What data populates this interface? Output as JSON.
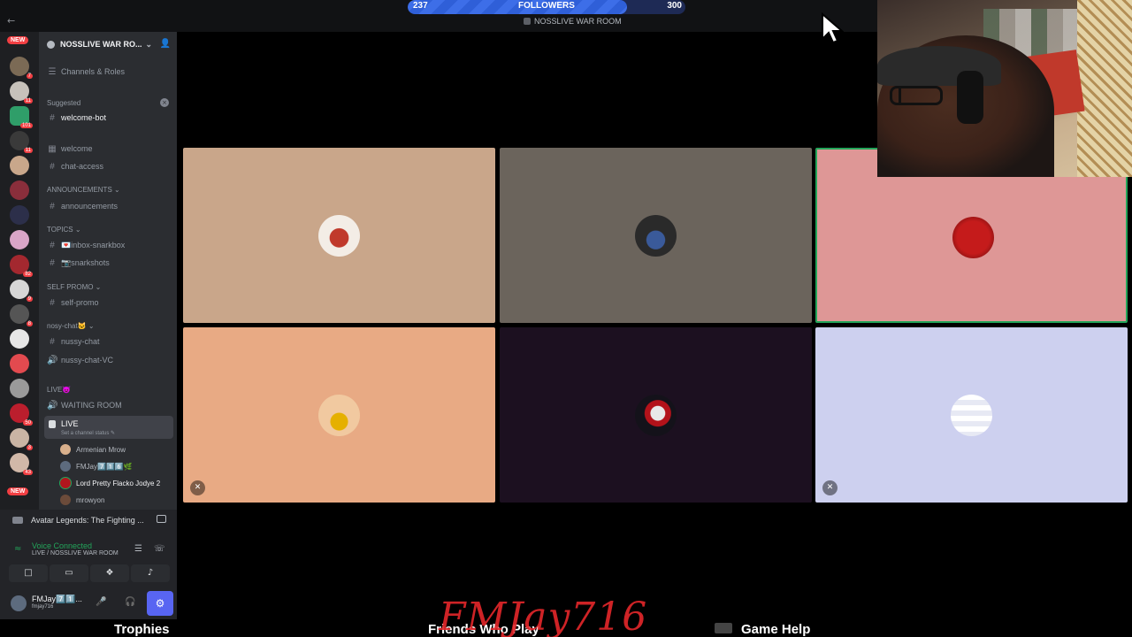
{
  "followers": {
    "current": "237",
    "label": "FOLLOWERS",
    "goal": "300",
    "progress": 0.79
  },
  "stream_room_label": "NOSSLIVE WAR ROOM",
  "rail": {
    "new_top": "NEW",
    "new_bottom": "NEW",
    "badges": [
      "7",
      "11",
      "101",
      "11",
      "82",
      "9",
      "8",
      "50",
      "3",
      "43"
    ]
  },
  "server": {
    "name": "NOSSLIVE WAR RO...",
    "channels_roles": "Channels & Roles"
  },
  "sidebar": {
    "suggested": "Suggested",
    "welcome_bot": "welcome-bot",
    "welcome": "welcome",
    "chat_access": "chat-access",
    "cat_announcements": "ANNOUNCEMENTS",
    "announcements": "announcements",
    "cat_topics": "TOPICS",
    "inbox": "💌inbox-snarkbox",
    "snarkshots": "📷snarkshots",
    "cat_self_promo": "SELF PROMO",
    "self_promo": "self-promo",
    "cat_nosy": "nosy-chat🐱",
    "nussy_chat": "nussy-chat",
    "nussy_vc": "nussy-chat-VC",
    "cat_live": "LIVE😈",
    "waiting_room": "WAITING ROOM",
    "live": "LIVE",
    "live_status": "Set a channel status ✎",
    "members": [
      "Armenian Mrow",
      "FMJay7️⃣1️⃣6️⃣🌿",
      "Lord Pretty Flacko Jodye 2",
      "mrowyon"
    ]
  },
  "activity": {
    "game": "Avatar Legends: The Fighting ..."
  },
  "voice": {
    "status": "Voice Connected",
    "room": "LIVE / NOSSLIVE WAR ROOM"
  },
  "user": {
    "name": "FMJay7️⃣1️⃣...",
    "handle": "fmjay716"
  },
  "bottom": {
    "trophies": "Trophies",
    "friends": "Friends Who Play",
    "game_help": "Game Help",
    "watermark": "FMJay716"
  },
  "colors": {
    "tile1": "#c9a68a",
    "tile2": "#6b645c",
    "tile3": "#de9796",
    "tile4": "#e8aa84",
    "tile5": "#1c1020",
    "tile6": "#cdd0ef",
    "accent": "#5865f2",
    "online": "#23a55a"
  }
}
